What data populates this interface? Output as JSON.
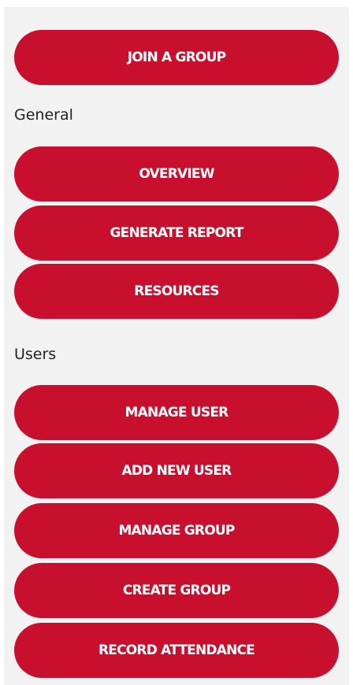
{
  "join_button": "JOIN A GROUP",
  "sections": {
    "general": {
      "label": "General",
      "items": [
        "OVERVIEW",
        "GENERATE REPORT",
        "RESOURCES"
      ]
    },
    "users": {
      "label": "Users",
      "items": [
        "MANAGE USER",
        "ADD NEW USER",
        "MANAGE GROUP",
        "CREATE GROUP",
        "RECORD ATTENDANCE"
      ]
    }
  },
  "colors": {
    "button_bg": "#c8102e",
    "button_text": "#ffffff",
    "panel_bg": "#f2f2f2"
  }
}
